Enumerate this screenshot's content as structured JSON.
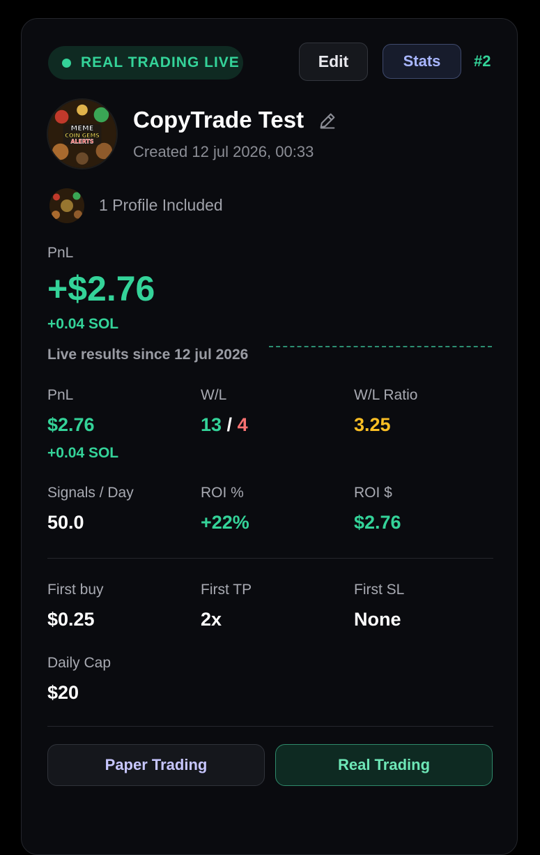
{
  "header": {
    "status_label": "REAL TRADING LIVE",
    "edit_label": "Edit",
    "stats_label": "Stats",
    "rank": "#2"
  },
  "profile": {
    "avatar_text": [
      "MEME",
      "COIN GEMS",
      "ALERTS"
    ],
    "title": "CopyTrade Test",
    "created": "Created 12 jul 2026, 00:33",
    "profiles_included": "1 Profile Included"
  },
  "summary": {
    "pnl_label": "PnL",
    "pnl_usd": "+$2.76",
    "pnl_sol": "+0.04 SOL",
    "since": "Live results since 12 jul 2026"
  },
  "stats": {
    "pnl_label": "PnL",
    "pnl_value": "$2.76",
    "pnl_sol": "+0.04 SOL",
    "wl_label": "W/L",
    "wins": "13",
    "wl_sep": " / ",
    "losses": "4",
    "wl_ratio_label": "W/L Ratio",
    "wl_ratio": "3.25",
    "signals_label": "Signals / Day",
    "signals": "50.0",
    "roi_pct_label": "ROI %",
    "roi_pct": "+22%",
    "roi_usd_label": "ROI $",
    "roi_usd": "$2.76"
  },
  "settings": {
    "first_buy_label": "First buy",
    "first_buy": "$0.25",
    "first_tp_label": "First TP",
    "first_tp": "2x",
    "first_sl_label": "First SL",
    "first_sl": "None",
    "daily_cap_label": "Daily Cap",
    "daily_cap": "$20"
  },
  "footer": {
    "paper_label": "Paper Trading",
    "real_label": "Real Trading"
  },
  "colors": {
    "positive": "#34d399",
    "negative": "#f87171",
    "ratio": "#fbbf24",
    "stats_accent": "#a8b6ff"
  },
  "icons": {
    "status": "live-dot-icon",
    "edit_title": "pencil-icon"
  }
}
